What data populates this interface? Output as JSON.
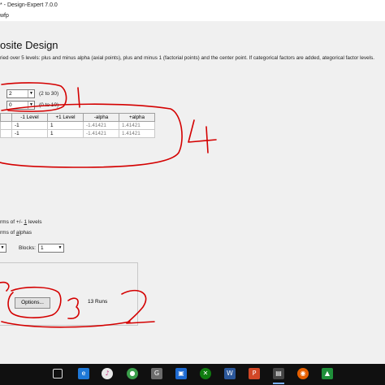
{
  "window": {
    "title": "* - Design-Expert 7.0.0",
    "subtitle": "wfp"
  },
  "page": {
    "heading": "osite Design",
    "description": "ried over 5 levels: plus and minus alpha (axial points), plus and minus 1 (factorial points) and the center point.  If categorical factors are added, ategorical factor levels."
  },
  "fields": {
    "factors_value": "2",
    "factors_hint": "(2 to 30)",
    "categoric_value": "0",
    "categoric_hint": "(0 to 10)"
  },
  "table": {
    "headers": [
      "",
      "-1 Level",
      "+1 Level",
      "-alpha",
      "+alpha"
    ],
    "rows": [
      [
        "",
        "-1",
        "1",
        "-1.41421",
        "1.41421"
      ],
      [
        "",
        "-1",
        "1",
        "-1.41421",
        "1.41421"
      ]
    ]
  },
  "options": {
    "line1_prefix": "rms of +/- ",
    "line1_key": "1",
    "line1_suffix": " levels",
    "line2_prefix": "rms of ",
    "line2_key": "a",
    "line2_suffix": "lphas",
    "blocks_label": "Blocks:",
    "blocks_value": "1"
  },
  "footer": {
    "options_button": "Options...",
    "runs": "13 Runs"
  },
  "annotations": {
    "mark1": "1",
    "mark2": "2",
    "mark3": "3",
    "mark4": "4"
  },
  "taskbar": {
    "icons": [
      "taskview-icon",
      "edge-icon",
      "itunes-icon",
      "chrome-icon",
      "file-explorer-icon",
      "photos-icon",
      "xbox-icon",
      "word-icon",
      "powerpoint-icon",
      "design-expert-icon",
      "firefox-icon",
      "green-app-icon"
    ]
  }
}
